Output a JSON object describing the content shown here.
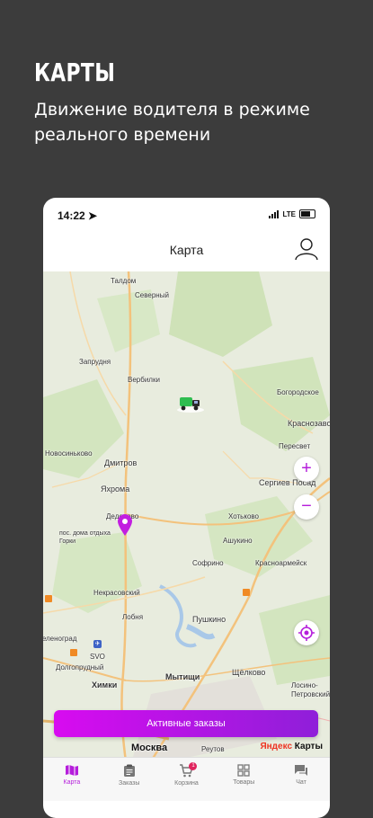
{
  "promo": {
    "title": "КАРТЫ",
    "subtitle": "Движение водителя в режиме реального времени"
  },
  "status_bar": {
    "time": "14:22",
    "network": "LTE"
  },
  "header": {
    "title": "Карта"
  },
  "map": {
    "labels": {
      "taldom": "Талдом",
      "severny": "Северный",
      "zaprudnya": "Запрудня",
      "verbilki": "Вербилки",
      "bogorodskoe": "Богородское",
      "krasnozavodsk": "Краснозаводск",
      "novosinkovo": "Новосиньково",
      "dmitrov": "Дмитров",
      "peresvet": "Пересвет",
      "sergiev_posad": "Сергиев Посад",
      "yakhroma": "Яхрома",
      "deduvo": "Деденево",
      "posad_gorki": "пос. дома отдыха Горки",
      "khotkovo": "Хотьково",
      "ashukino": "Ашукино",
      "sofrino": "Софрино",
      "krasnoarmeysk": "Красноармейск",
      "nekrasovsky": "Некрасовский",
      "lobnya": "Лобня",
      "pushkino": "Пушкино",
      "zelenograd": "Зеленоград",
      "svo": "SVO",
      "dolgoprudny": "Долгопрудный",
      "khimki": "Химки",
      "mytishchi": "Мытищи",
      "shchelkovo": "Щёлково",
      "losino": "Лосино-Петровский",
      "moskva": "Москва",
      "reutov": "Реутов"
    },
    "zoom_in": "+",
    "zoom_out": "−",
    "yandex_brand": "Яндекс",
    "yandex_suffix": " Карты"
  },
  "active_orders_button": "Активные заказы",
  "tabs": [
    {
      "label": "Карта",
      "icon": "map-icon"
    },
    {
      "label": "Заказы",
      "icon": "clipboard-icon"
    },
    {
      "label": "Корзина",
      "icon": "cart-icon",
      "badge": "1"
    },
    {
      "label": "Товары",
      "icon": "grid-icon"
    },
    {
      "label": "Чат",
      "icon": "chat-icon"
    }
  ],
  "colors": {
    "accent": "#b51edb",
    "truck": "#2ebd4f",
    "background": "#3c3c3c"
  }
}
